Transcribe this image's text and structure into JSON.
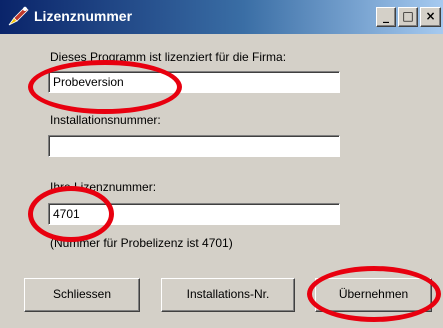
{
  "window": {
    "title": "Lizenznummer",
    "minimize_glyph": "_",
    "maximize_glyph": "□",
    "close_glyph": "×"
  },
  "form": {
    "company_label": "Dieses Programm ist lizenziert für die Firma:",
    "company_value": "Probeversion",
    "install_label": "Installationsnummer:",
    "install_value": "",
    "license_label": "Ihre Lizenznummer:",
    "license_value": "4701",
    "hint": "(Nummer für Probelizenz ist 4701)"
  },
  "buttons": {
    "close": "Schliessen",
    "install_no": "Installations-Nr.",
    "apply": "Übernehmen"
  },
  "annotation_color": "#e8000f"
}
